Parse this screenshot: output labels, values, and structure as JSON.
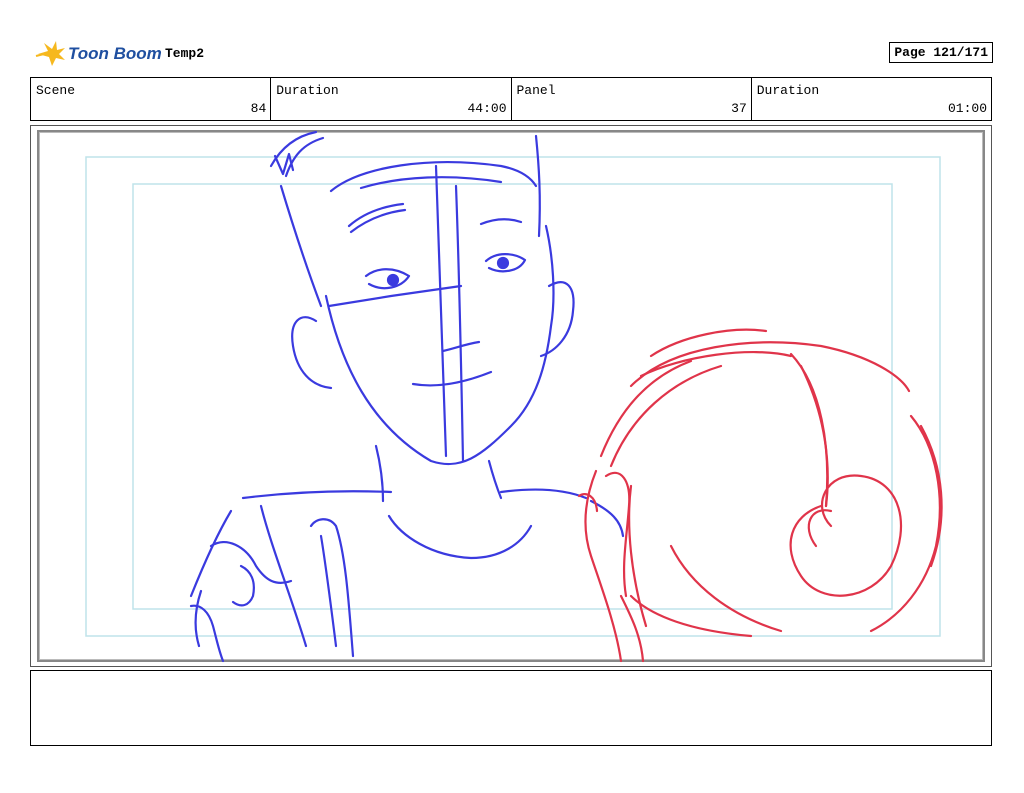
{
  "header": {
    "brand": "Toon Boom",
    "project_title": "Temp2",
    "page_label": "Page 121/171"
  },
  "info": [
    {
      "label": "Scene",
      "value": "84"
    },
    {
      "label": "Duration",
      "value": "44:00"
    },
    {
      "label": "Panel",
      "value": "37"
    },
    {
      "label": "Duration",
      "value": "01:00"
    }
  ],
  "colors": {
    "sketch_blue": "#3a3adf",
    "sketch_red": "#e0344a",
    "safe_frame": "#bfe3ea",
    "logo_yellow": "#f6b81e",
    "logo_blue": "#1f4fa0"
  },
  "notes": ""
}
